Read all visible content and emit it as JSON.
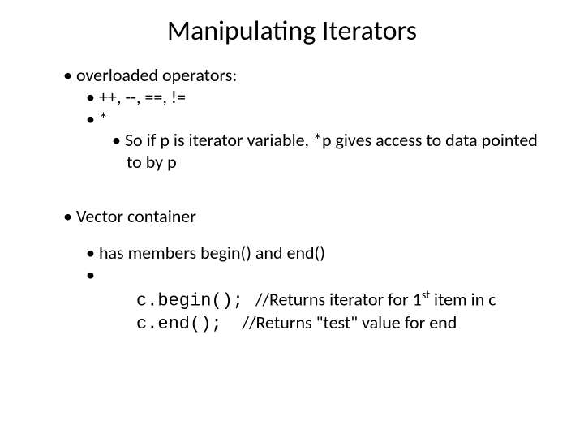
{
  "title": "Manipulating Iterators",
  "l1": {
    "overloaded": "overloaded operators:",
    "vector": "Vector container"
  },
  "l2": {
    "ops": "++, --, ==, !=",
    "star": "*",
    "members": "has members begin() and end()",
    "blank": ""
  },
  "l3": {
    "soif": "So if p is iterator variable, *p gives access to data pointed to by p"
  },
  "code": {
    "begin": "c.begin();",
    "end": "c.end();"
  },
  "comment": {
    "begin_pre": "//Returns iterator for 1",
    "begin_post": " item in c",
    "begin_sup": "st",
    "end": "//Returns \"test\" value for end"
  }
}
